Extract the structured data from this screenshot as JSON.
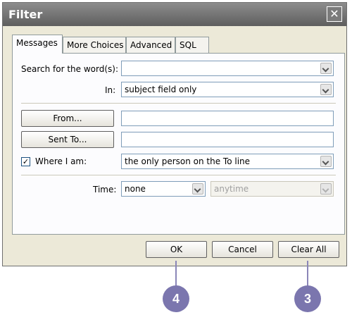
{
  "window": {
    "title": "Filter",
    "close_glyph": "✕"
  },
  "tabs": [
    {
      "label": "Messages",
      "active": true
    },
    {
      "label": "More Choices",
      "active": false
    },
    {
      "label": "Advanced",
      "active": false
    },
    {
      "label": "SQL",
      "active": false
    }
  ],
  "messages": {
    "search_label": "Search for the word(s):",
    "search_value": "",
    "in_label": "In:",
    "in_value": "subject field only",
    "from_button": "From...",
    "from_value": "",
    "sent_to_button": "Sent To...",
    "sent_to_value": "",
    "where_checked": true,
    "where_check_glyph": "✓",
    "where_label": "Where I am:",
    "where_value": "the only person on the To line",
    "time_label": "Time:",
    "time_value": "none",
    "time_range_value": "anytime"
  },
  "buttons": {
    "ok": "OK",
    "cancel": "Cancel",
    "clear_all": "Clear All"
  },
  "callouts": {
    "ok_step": "4",
    "clear_all_step": "3"
  },
  "colors": {
    "callout": "#7b76ae",
    "titlebar": "#6e6e6e"
  },
  "icons": {
    "close": "close-icon",
    "combo_arrow": "chevron-down-icon",
    "check": "check-icon"
  }
}
